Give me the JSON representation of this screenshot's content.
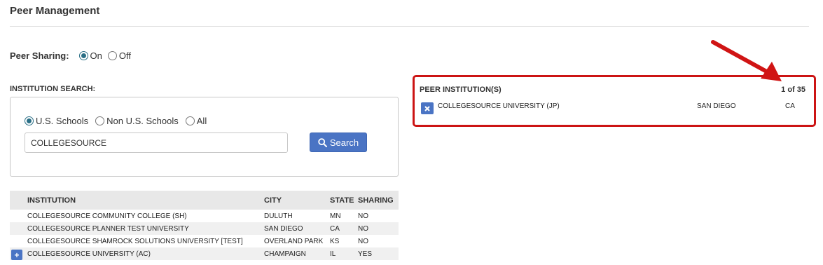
{
  "page": {
    "title": "Peer Management"
  },
  "peer_sharing": {
    "label": "Peer Sharing:",
    "options": [
      {
        "label": "On",
        "checked": true
      },
      {
        "label": "Off",
        "checked": false
      }
    ]
  },
  "search": {
    "label": "INSTITUTION SEARCH:",
    "scopes": [
      {
        "label": "U.S. Schools",
        "checked": true
      },
      {
        "label": "Non U.S. Schools",
        "checked": false
      },
      {
        "label": "All",
        "checked": false
      }
    ],
    "query": "COLLEGESOURCE",
    "button_label": "Search",
    "button_icon": "search-icon"
  },
  "results": {
    "columns": [
      "INSTITUTION",
      "CITY",
      "STATE",
      "SHARING"
    ],
    "rows": [
      {
        "institution": "COLLEGESOURCE COMMUNITY COLLEGE (SH)",
        "city": "DULUTH",
        "state": "MN",
        "sharing": "NO",
        "addable": false
      },
      {
        "institution": "COLLEGESOURCE PLANNER TEST UNIVERSITY",
        "city": "SAN DIEGO",
        "state": "CA",
        "sharing": "NO",
        "addable": false
      },
      {
        "institution": "COLLEGESOURCE SHAMROCK SOLUTIONS UNIVERSITY [TEST]",
        "city": "OVERLAND PARK",
        "state": "KS",
        "sharing": "NO",
        "addable": false
      },
      {
        "institution": "COLLEGESOURCE UNIVERSITY (AC)",
        "city": "CHAMPAIGN",
        "state": "IL",
        "sharing": "YES",
        "addable": true
      }
    ],
    "add_icon": "plus-icon"
  },
  "peers": {
    "heading": "PEER INSTITUTION(S)",
    "count": "1 of 35",
    "remove_icon": "close-icon",
    "items": [
      {
        "institution": "COLLEGESOURCE UNIVERSITY (JP)",
        "city": "SAN DIEGO",
        "state": "CA"
      }
    ]
  },
  "colors": {
    "accent": "#4a74c4",
    "radio_checked": "#2a6f86",
    "highlight": "#cc1414"
  }
}
